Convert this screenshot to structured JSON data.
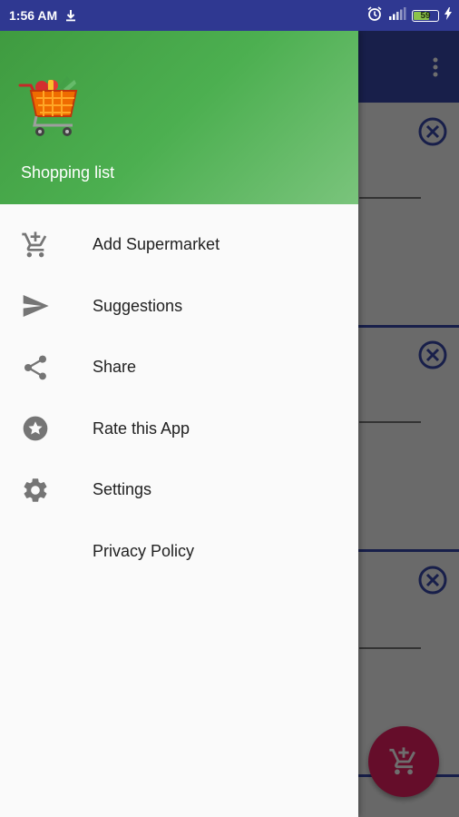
{
  "status_bar": {
    "time": "1:56 AM",
    "battery_level": "59",
    "icons": [
      "download-icon",
      "alarm-icon",
      "signal-icon",
      "battery-icon",
      "charging-icon"
    ]
  },
  "drawer": {
    "header": {
      "title": "Shopping list",
      "logo": "shopping-cart-logo",
      "gradient_colors": [
        "#3f9b40",
        "#7ac47c"
      ]
    },
    "items": [
      {
        "label": "Add Supermarket",
        "icon": "add-cart-icon"
      },
      {
        "label": "Suggestions",
        "icon": "send-icon"
      },
      {
        "label": "Share",
        "icon": "share-icon"
      },
      {
        "label": "Rate this App",
        "icon": "star-icon"
      },
      {
        "label": "Settings",
        "icon": "gear-icon"
      },
      {
        "label": "Privacy Policy",
        "icon": ""
      }
    ]
  },
  "colors": {
    "status_bar": "#2f3891",
    "toolbar": "#3949ab",
    "accent": "#e91e63",
    "drawer_text": "#212121"
  }
}
